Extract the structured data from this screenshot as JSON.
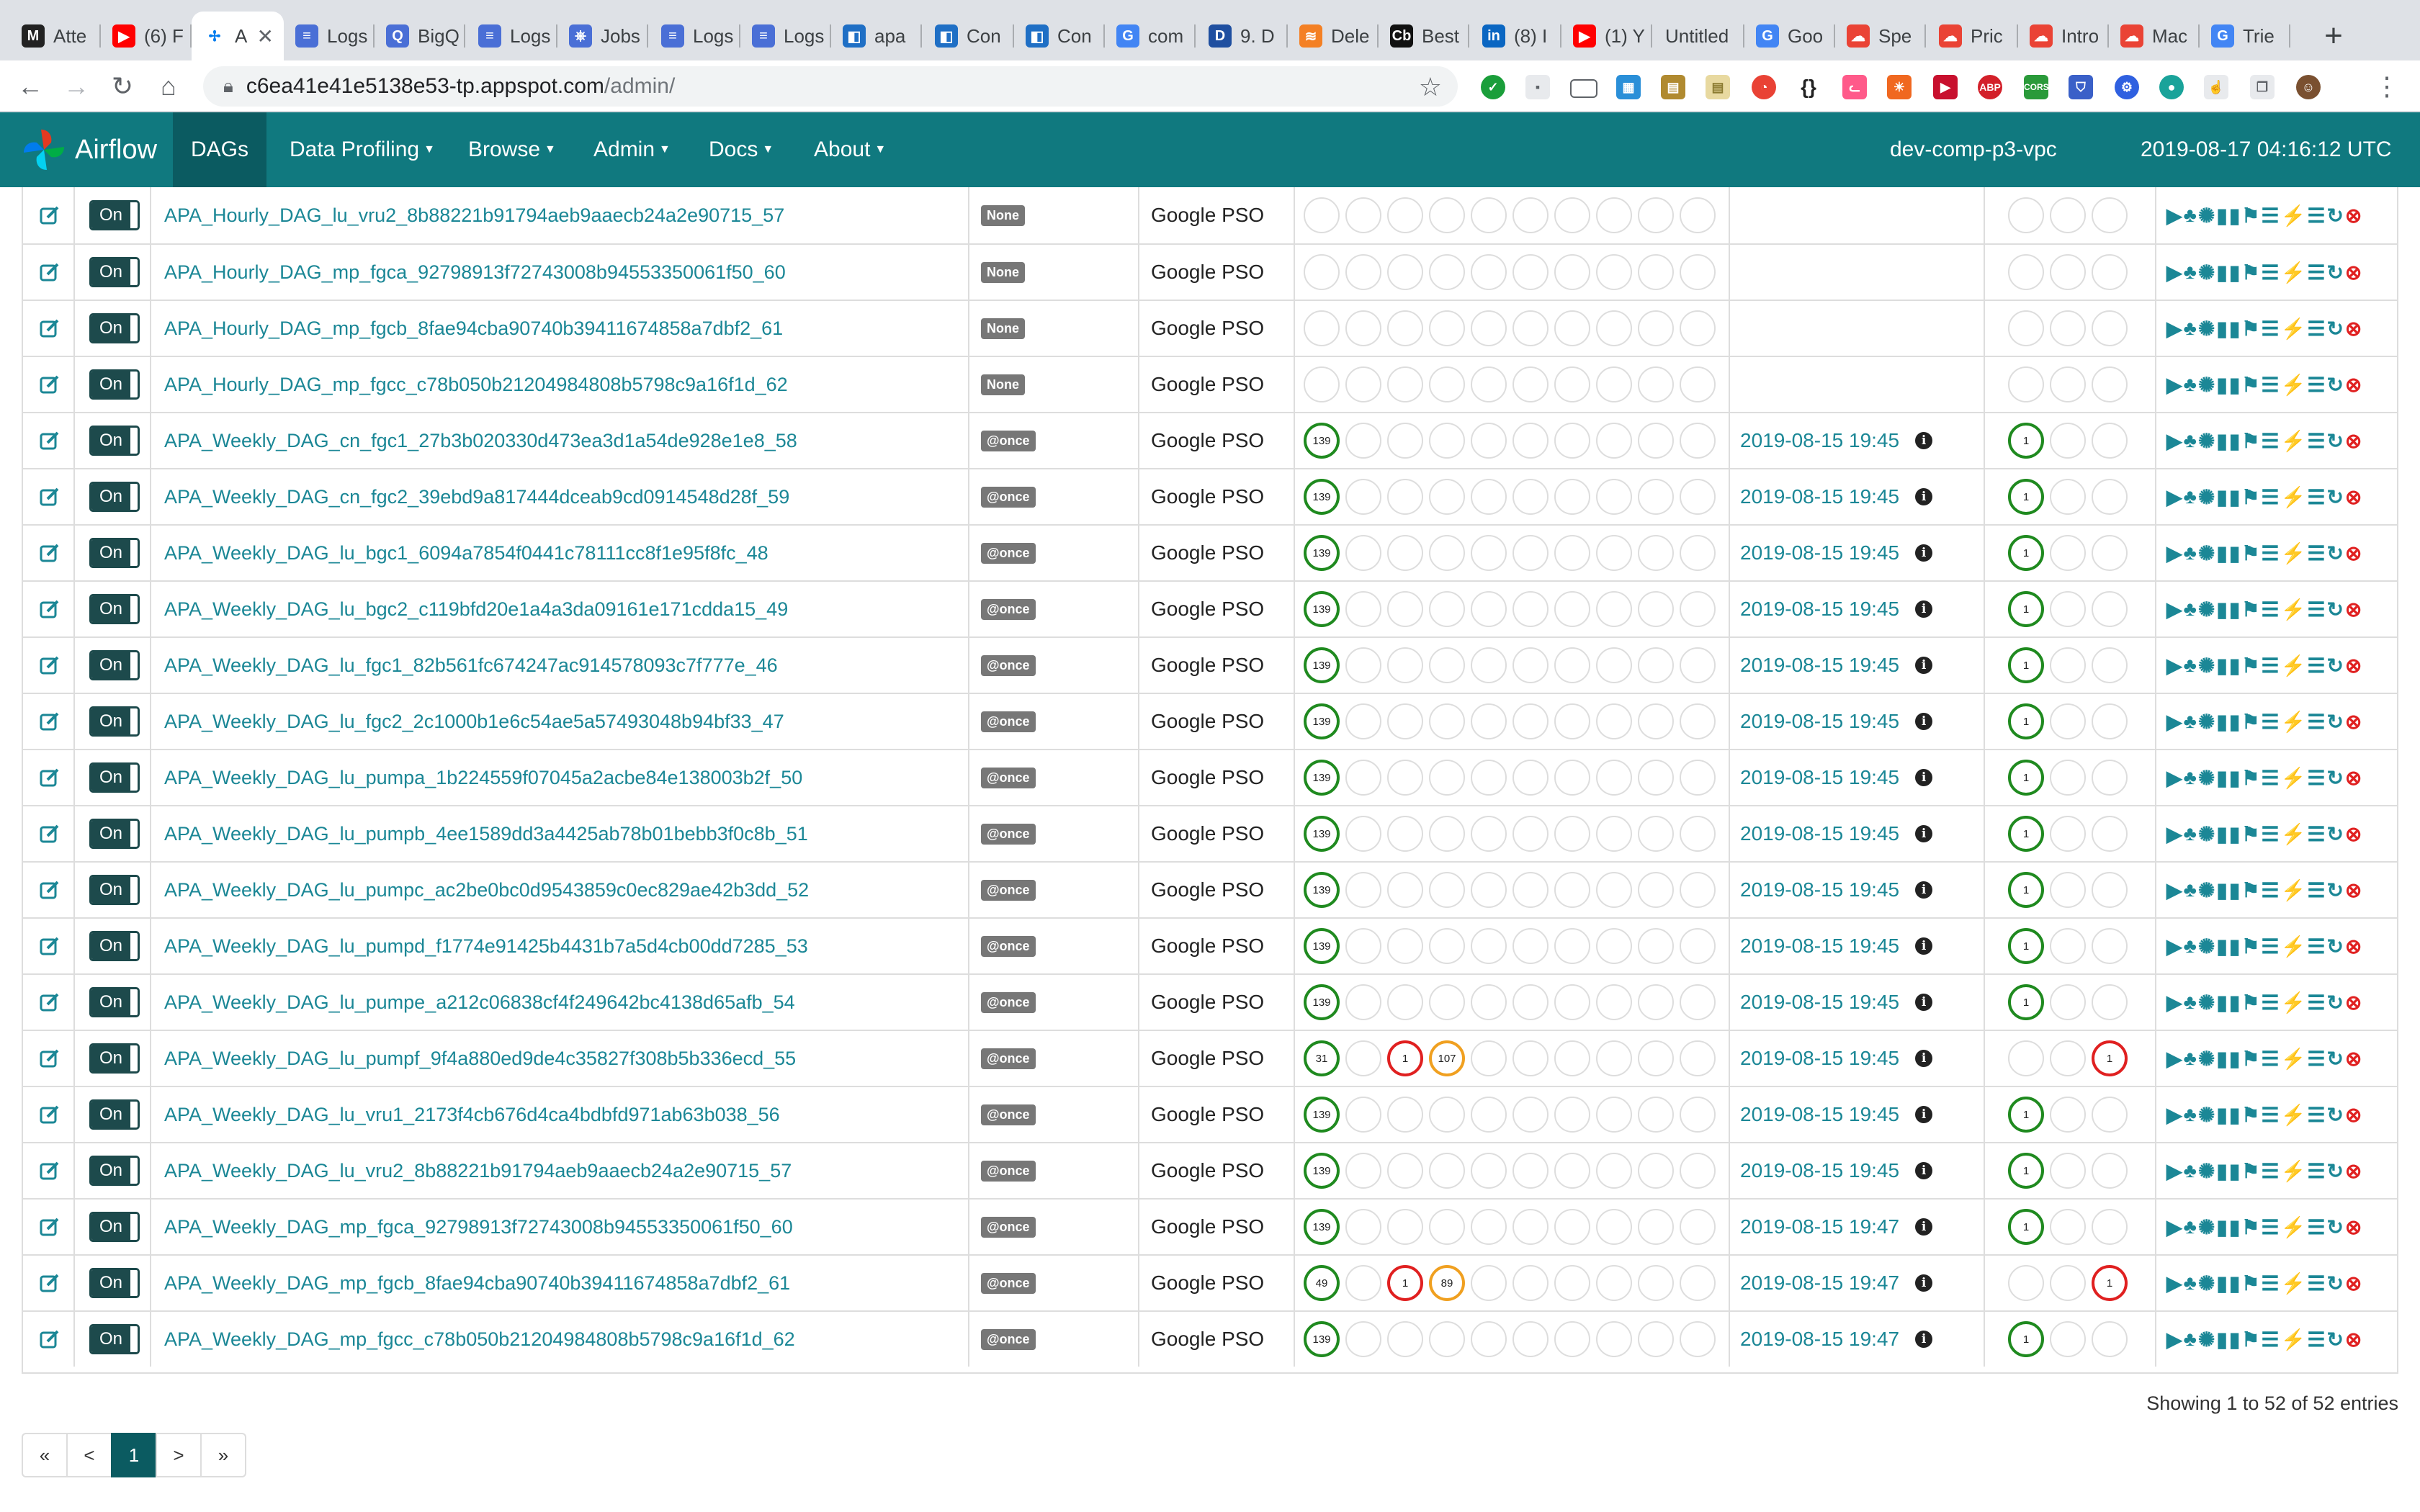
{
  "browser": {
    "tabs": [
      {
        "title": "Atte",
        "icon": "gmail-icon",
        "color": "#222222",
        "glyph": "M"
      },
      {
        "title": "(6) F",
        "icon": "youtube-icon",
        "color": "#ff0000",
        "glyph": "▶"
      },
      {
        "title": "A",
        "icon": "airflow-icon",
        "color": "#ffffff",
        "glyph": "✢",
        "active": true
      },
      {
        "title": "Logs",
        "icon": "logs-icon",
        "color": "#4a6fd6",
        "glyph": "≡"
      },
      {
        "title": "BigQ",
        "icon": "bigquery-icon",
        "color": "#4a6fd6",
        "glyph": "Q"
      },
      {
        "title": "Logs",
        "icon": "logs-icon",
        "color": "#4a6fd6",
        "glyph": "≡"
      },
      {
        "title": "Jobs",
        "icon": "kubernetes-icon",
        "color": "#4a6fd6",
        "glyph": "⎈"
      },
      {
        "title": "Logs",
        "icon": "logs-icon",
        "color": "#4a6fd6",
        "glyph": "≡"
      },
      {
        "title": "Logs",
        "icon": "logs-icon",
        "color": "#4a6fd6",
        "glyph": "≡"
      },
      {
        "title": "apa",
        "icon": "azure-devops-icon",
        "color": "#1f6fc5",
        "glyph": "◧"
      },
      {
        "title": "Con",
        "icon": "azure-devops-icon",
        "color": "#1f6fc5",
        "glyph": "◧"
      },
      {
        "title": "Con",
        "icon": "azure-devops-icon",
        "color": "#1f6fc5",
        "glyph": "◧"
      },
      {
        "title": "com",
        "icon": "google-icon",
        "color": "#4285f4",
        "glyph": "G"
      },
      {
        "title": "9. D",
        "icon": "udemy-icon",
        "color": "#1f4fa0",
        "glyph": "D"
      },
      {
        "title": "Dele",
        "icon": "stack-icon",
        "color": "#f48024",
        "glyph": "≋"
      },
      {
        "title": "Best",
        "icon": "cb-icon",
        "color": "#111111",
        "glyph": "Cb"
      },
      {
        "title": "(8) I",
        "icon": "linkedin-icon",
        "color": "#0a66c2",
        "glyph": "in"
      },
      {
        "title": "(1) Y",
        "icon": "youtube-icon",
        "color": "#ff0000",
        "glyph": "▶"
      },
      {
        "title": "Untitled",
        "icon": "blank-icon",
        "color": "",
        "glyph": ""
      },
      {
        "title": "Goo",
        "icon": "google-icon",
        "color": "#4285f4",
        "glyph": "G"
      },
      {
        "title": "Spe",
        "icon": "gcp-icon",
        "color": "#ea4335",
        "glyph": "☁"
      },
      {
        "title": "Pric",
        "icon": "gcp-icon",
        "color": "#ea4335",
        "glyph": "☁"
      },
      {
        "title": "Intro",
        "icon": "gcp-icon",
        "color": "#ea4335",
        "glyph": "☁"
      },
      {
        "title": "Mac",
        "icon": "gcp-icon",
        "color": "#ea4335",
        "glyph": "☁"
      },
      {
        "title": "Trie",
        "icon": "google-icon",
        "color": "#4285f4",
        "glyph": "G"
      }
    ],
    "url_host": "c6ea41e41e5138e53-tp.appspot.com",
    "url_path": "/admin/"
  },
  "navbar": {
    "brand": "Airflow",
    "active": "DAGs",
    "menus": [
      "Data Profiling",
      "Browse",
      "Admin",
      "Docs",
      "About"
    ],
    "environment": "dev-comp-p3-vpc",
    "clock": "2019-08-17 04:16:12 UTC"
  },
  "dags": [
    {
      "dag_id": "APA_Hourly_DAG_lu_vru2_8b88221b91794aeb9aaecb24a2e90715_57",
      "schedule": "None",
      "owner": "Google PSO",
      "runs": {
        "success": null,
        "failed": null,
        "running": null
      },
      "last_run": "",
      "recent": [
        null,
        null,
        null
      ]
    },
    {
      "dag_id": "APA_Hourly_DAG_mp_fgca_92798913f72743008b94553350061f50_60",
      "schedule": "None",
      "owner": "Google PSO",
      "runs": {
        "success": null,
        "failed": null,
        "running": null
      },
      "last_run": "",
      "recent": [
        null,
        null,
        null
      ]
    },
    {
      "dag_id": "APA_Hourly_DAG_mp_fgcb_8fae94cba90740b39411674858a7dbf2_61",
      "schedule": "None",
      "owner": "Google PSO",
      "runs": {
        "success": null,
        "failed": null,
        "running": null
      },
      "last_run": "",
      "recent": [
        null,
        null,
        null
      ]
    },
    {
      "dag_id": "APA_Hourly_DAG_mp_fgcc_c78b050b21204984808b5798c9a16f1d_62",
      "schedule": "None",
      "owner": "Google PSO",
      "runs": {
        "success": null,
        "failed": null,
        "running": null
      },
      "last_run": "",
      "recent": [
        null,
        null,
        null
      ]
    },
    {
      "dag_id": "APA_Weekly_DAG_cn_fgc1_27b3b020330d473ea3d1a54de928e1e8_58",
      "schedule": "@once",
      "owner": "Google PSO",
      "runs": {
        "success": "139",
        "failed": null,
        "running": null
      },
      "last_run": "2019-08-15 19:45",
      "recent": [
        "1",
        null,
        null
      ]
    },
    {
      "dag_id": "APA_Weekly_DAG_cn_fgc2_39ebd9a817444dceab9cd0914548d28f_59",
      "schedule": "@once",
      "owner": "Google PSO",
      "runs": {
        "success": "139",
        "failed": null,
        "running": null
      },
      "last_run": "2019-08-15 19:45",
      "recent": [
        "1",
        null,
        null
      ]
    },
    {
      "dag_id": "APA_Weekly_DAG_lu_bgc1_6094a7854f0441c78111cc8f1e95f8fc_48",
      "schedule": "@once",
      "owner": "Google PSO",
      "runs": {
        "success": "139",
        "failed": null,
        "running": null
      },
      "last_run": "2019-08-15 19:45",
      "recent": [
        "1",
        null,
        null
      ]
    },
    {
      "dag_id": "APA_Weekly_DAG_lu_bgc2_c119bfd20e1a4a3da09161e171cdda15_49",
      "schedule": "@once",
      "owner": "Google PSO",
      "runs": {
        "success": "139",
        "failed": null,
        "running": null
      },
      "last_run": "2019-08-15 19:45",
      "recent": [
        "1",
        null,
        null
      ]
    },
    {
      "dag_id": "APA_Weekly_DAG_lu_fgc1_82b561fc674247ac914578093c7f777e_46",
      "schedule": "@once",
      "owner": "Google PSO",
      "runs": {
        "success": "139",
        "failed": null,
        "running": null
      },
      "last_run": "2019-08-15 19:45",
      "recent": [
        "1",
        null,
        null
      ]
    },
    {
      "dag_id": "APA_Weekly_DAG_lu_fgc2_2c1000b1e6c54ae5a57493048b94bf33_47",
      "schedule": "@once",
      "owner": "Google PSO",
      "runs": {
        "success": "139",
        "failed": null,
        "running": null
      },
      "last_run": "2019-08-15 19:45",
      "recent": [
        "1",
        null,
        null
      ]
    },
    {
      "dag_id": "APA_Weekly_DAG_lu_pumpa_1b224559f07045a2acbe84e138003b2f_50",
      "schedule": "@once",
      "owner": "Google PSO",
      "runs": {
        "success": "139",
        "failed": null,
        "running": null
      },
      "last_run": "2019-08-15 19:45",
      "recent": [
        "1",
        null,
        null
      ]
    },
    {
      "dag_id": "APA_Weekly_DAG_lu_pumpb_4ee1589dd3a4425ab78b01bebb3f0c8b_51",
      "schedule": "@once",
      "owner": "Google PSO",
      "runs": {
        "success": "139",
        "failed": null,
        "running": null
      },
      "last_run": "2019-08-15 19:45",
      "recent": [
        "1",
        null,
        null
      ]
    },
    {
      "dag_id": "APA_Weekly_DAG_lu_pumpc_ac2be0bc0d9543859c0ec829ae42b3dd_52",
      "schedule": "@once",
      "owner": "Google PSO",
      "runs": {
        "success": "139",
        "failed": null,
        "running": null
      },
      "last_run": "2019-08-15 19:45",
      "recent": [
        "1",
        null,
        null
      ]
    },
    {
      "dag_id": "APA_Weekly_DAG_lu_pumpd_f1774e91425b4431b7a5d4cb00dd7285_53",
      "schedule": "@once",
      "owner": "Google PSO",
      "runs": {
        "success": "139",
        "failed": null,
        "running": null
      },
      "last_run": "2019-08-15 19:45",
      "recent": [
        "1",
        null,
        null
      ]
    },
    {
      "dag_id": "APA_Weekly_DAG_lu_pumpe_a212c06838cf4f249642bc4138d65afb_54",
      "schedule": "@once",
      "owner": "Google PSO",
      "runs": {
        "success": "139",
        "failed": null,
        "running": null
      },
      "last_run": "2019-08-15 19:45",
      "recent": [
        "1",
        null,
        null
      ]
    },
    {
      "dag_id": "APA_Weekly_DAG_lu_pumpf_9f4a880ed9de4c35827f308b5b336ecd_55",
      "schedule": "@once",
      "owner": "Google PSO",
      "runs": {
        "success": "31",
        "failed": "1",
        "running": "107"
      },
      "last_run": "2019-08-15 19:45",
      "recent": [
        null,
        null,
        "1"
      ]
    },
    {
      "dag_id": "APA_Weekly_DAG_lu_vru1_2173f4cb676d4ca4bdbfd971ab63b038_56",
      "schedule": "@once",
      "owner": "Google PSO",
      "runs": {
        "success": "139",
        "failed": null,
        "running": null
      },
      "last_run": "2019-08-15 19:45",
      "recent": [
        "1",
        null,
        null
      ]
    },
    {
      "dag_id": "APA_Weekly_DAG_lu_vru2_8b88221b91794aeb9aaecb24a2e90715_57",
      "schedule": "@once",
      "owner": "Google PSO",
      "runs": {
        "success": "139",
        "failed": null,
        "running": null
      },
      "last_run": "2019-08-15 19:45",
      "recent": [
        "1",
        null,
        null
      ]
    },
    {
      "dag_id": "APA_Weekly_DAG_mp_fgca_92798913f72743008b94553350061f50_60",
      "schedule": "@once",
      "owner": "Google PSO",
      "runs": {
        "success": "139",
        "failed": null,
        "running": null
      },
      "last_run": "2019-08-15 19:47",
      "recent": [
        "1",
        null,
        null
      ]
    },
    {
      "dag_id": "APA_Weekly_DAG_mp_fgcb_8fae94cba90740b39411674858a7dbf2_61",
      "schedule": "@once",
      "owner": "Google PSO",
      "runs": {
        "success": "49",
        "failed": "1",
        "running": "89"
      },
      "last_run": "2019-08-15 19:47",
      "recent": [
        null,
        null,
        "1"
      ]
    },
    {
      "dag_id": "APA_Weekly_DAG_mp_fgcc_c78b050b21204984808b5798c9a16f1d_62",
      "schedule": "@once",
      "owner": "Google PSO",
      "runs": {
        "success": "139",
        "failed": null,
        "running": null
      },
      "last_run": "2019-08-15 19:47",
      "recent": [
        "1",
        null,
        null
      ]
    }
  ],
  "toggle_label": "On",
  "footer": {
    "showing": "Showing 1 to 52 of 52 entries",
    "pagination": [
      "«",
      "<",
      "1",
      ">",
      "»"
    ],
    "current_page": "1"
  },
  "colors": {
    "navbar": "#10797f",
    "active_nav": "#0b5b61",
    "link": "#1b8796",
    "success": "#1f8a1f",
    "failed": "#e02020",
    "running": "#f0a020"
  }
}
